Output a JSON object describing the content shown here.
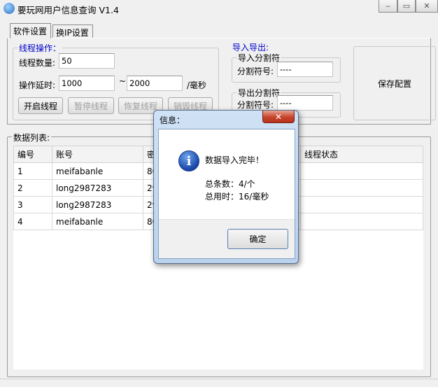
{
  "window": {
    "title": "要玩网用户信息查询 V1.4"
  },
  "tabs": [
    {
      "label": "软件设置"
    },
    {
      "label": "换IP设置"
    }
  ],
  "thread_ops": {
    "legend": "线程操作：",
    "count_label": "线程数量:",
    "count_value": "50",
    "delay_label": "操作延时:",
    "delay_min": "1000",
    "delay_tilde": "~",
    "delay_max": "2000",
    "delay_unit": "/毫秒",
    "buttons": {
      "start": "开启线程",
      "pause": "暂停线程",
      "resume": "恢复线程",
      "destroy": "销毁线程"
    }
  },
  "import_export": {
    "legend": "导入导出:",
    "import_group": "导入分割符",
    "import_label": "分割符号:",
    "import_value": "----",
    "export_group": "导出分割符",
    "export_label": "分割符号:",
    "export_value": "----"
  },
  "save_button": "保存配置",
  "data_list": {
    "legend": "数据列表:",
    "columns": [
      "编号",
      "账号",
      "密",
      "线程状态"
    ],
    "rows": [
      {
        "id": "1",
        "account": "meifabanle",
        "pwd": "80"
      },
      {
        "id": "2",
        "account": "long2987283",
        "pwd": "29"
      },
      {
        "id": "3",
        "account": "long2987283",
        "pwd": "29"
      },
      {
        "id": "4",
        "account": "meifabanle",
        "pwd": "80"
      }
    ]
  },
  "dialog": {
    "title": "信息：",
    "close": "✕",
    "icon": "info-icon",
    "message": "数据导入完毕！",
    "total_line": "总条数：4/个",
    "time_line": "总用时：16/毫秒",
    "ok": "确定"
  }
}
